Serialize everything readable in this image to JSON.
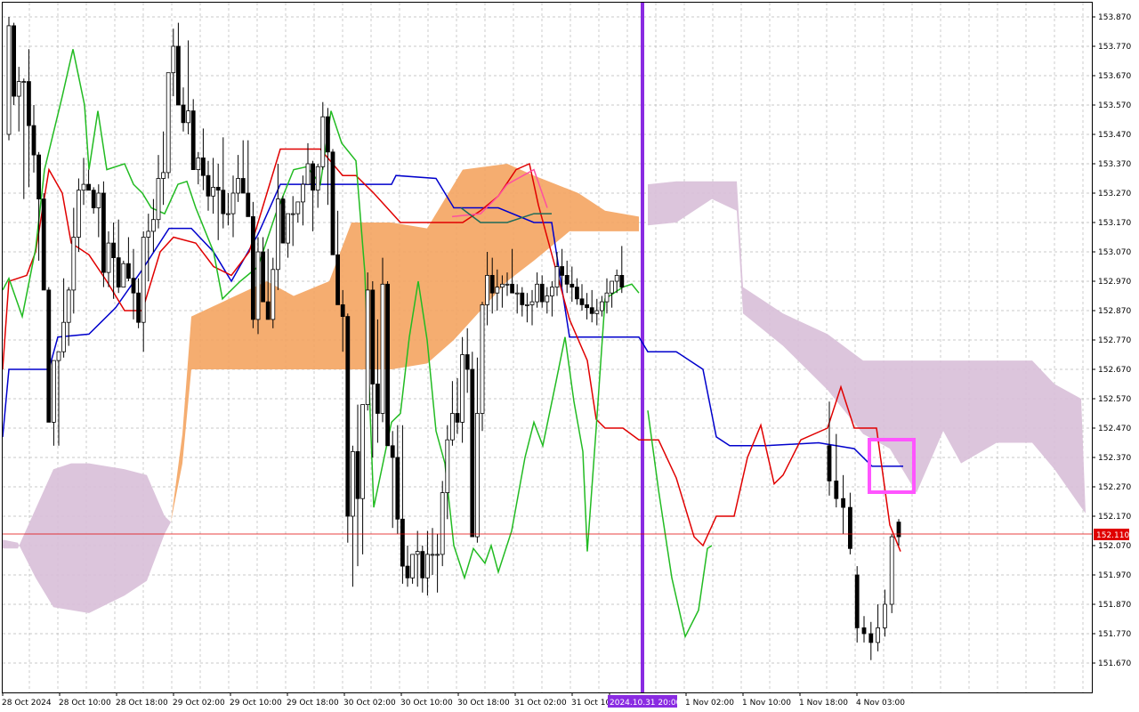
{
  "chart_data": {
    "type": "candlestick",
    "y_axis": {
      "ticks": [
        "153.870",
        "153.770",
        "153.670",
        "153.570",
        "153.470",
        "153.370",
        "153.270",
        "153.170",
        "153.070",
        "152.970",
        "152.870",
        "152.770",
        "152.670",
        "152.570",
        "152.470",
        "152.370",
        "152.270",
        "152.170",
        "152.070",
        "151.970",
        "151.870",
        "151.770",
        "151.670"
      ],
      "range": [
        151.61,
        153.91
      ]
    },
    "x_axis": {
      "labels": [
        "28 Oct 2024",
        "28 Oct 10:00",
        "28 Oct 18:00",
        "29 Oct 02:00",
        "29 Oct 10:00",
        "29 Oct 18:00",
        "30 Oct 02:00",
        "30 Oct 10:00",
        "30 Oct 18:00",
        "31 Oct 02:00",
        "31 Oct 10:00",
        "2024.10.31 20:00",
        "1 Nov 02:00",
        "1 Nov 10:00",
        "1 Nov 18:00",
        "4 Nov 03:00"
      ],
      "highlighted_label": "2024.10.31 20:00"
    },
    "current_price": {
      "value": 152.11,
      "label": "152.110"
    },
    "candles": [
      [
        153.47,
        153.87,
        153.45,
        153.84
      ],
      [
        153.84,
        153.85,
        153.57,
        153.6
      ],
      [
        153.6,
        153.7,
        153.48,
        153.65
      ],
      [
        153.65,
        153.66,
        153.25,
        153.65
      ],
      [
        153.65,
        153.76,
        153.29,
        153.5
      ],
      [
        153.5,
        153.57,
        153.34,
        153.4
      ],
      [
        153.4,
        153.41,
        153.04,
        153.25
      ],
      [
        153.25,
        153.27,
        152.94,
        152.94
      ],
      [
        152.94,
        152.95,
        152.49,
        152.49
      ],
      [
        152.49,
        152.7,
        152.41,
        152.7
      ],
      [
        152.7,
        152.73,
        152.41,
        152.73
      ],
      [
        152.73,
        152.98,
        152.71,
        152.83
      ],
      [
        152.83,
        152.95,
        152.75,
        152.94
      ],
      [
        152.94,
        153.22,
        152.86,
        153.12
      ],
      [
        153.12,
        153.32,
        153.07,
        153.28
      ],
      [
        153.28,
        153.39,
        153.23,
        153.3
      ],
      [
        153.3,
        153.35,
        153.28,
        153.28
      ],
      [
        153.28,
        153.29,
        153.2,
        153.22
      ],
      [
        153.22,
        153.3,
        153.12,
        153.27
      ],
      [
        153.27,
        153.31,
        152.95,
        153.0
      ],
      [
        153.0,
        153.14,
        152.95,
        153.1
      ],
      [
        153.1,
        153.17,
        152.91,
        153.05
      ],
      [
        153.05,
        153.18,
        152.93,
        152.95
      ],
      [
        152.95,
        153.04,
        152.95,
        153.03
      ],
      [
        153.03,
        153.12,
        152.97,
        152.98
      ],
      [
        152.98,
        153.08,
        152.84,
        152.93
      ],
      [
        152.93,
        152.98,
        152.81,
        152.83
      ],
      [
        152.83,
        153.14,
        152.73,
        153.12
      ],
      [
        153.12,
        153.2,
        152.97,
        153.14
      ],
      [
        153.14,
        153.25,
        153.07,
        153.18
      ],
      [
        153.18,
        153.4,
        153.15,
        153.32
      ],
      [
        153.32,
        153.48,
        153.23,
        153.34
      ],
      [
        153.34,
        153.68,
        153.32,
        153.68
      ],
      [
        153.68,
        153.83,
        153.6,
        153.77
      ],
      [
        153.77,
        153.85,
        153.6,
        153.57
      ],
      [
        153.57,
        153.63,
        153.48,
        153.51
      ],
      [
        153.51,
        153.79,
        153.47,
        153.55
      ],
      [
        153.55,
        153.59,
        153.35,
        153.35
      ],
      [
        153.35,
        153.41,
        153.3,
        153.39
      ],
      [
        153.39,
        153.49,
        153.28,
        153.33
      ],
      [
        153.33,
        153.38,
        153.21,
        153.26
      ],
      [
        153.26,
        153.39,
        153.2,
        153.29
      ],
      [
        153.29,
        153.37,
        153.11,
        153.28
      ],
      [
        153.28,
        153.46,
        153.15,
        153.2
      ],
      [
        153.2,
        153.27,
        153.16,
        153.2
      ],
      [
        153.2,
        153.33,
        153.12,
        153.27
      ],
      [
        153.27,
        153.4,
        153.24,
        153.32
      ],
      [
        153.32,
        153.45,
        153.27,
        153.27
      ],
      [
        153.27,
        153.45,
        153.21,
        153.19
      ],
      [
        153.19,
        153.24,
        152.81,
        152.84
      ],
      [
        152.84,
        153.12,
        152.79,
        153.07
      ],
      [
        153.07,
        153.12,
        152.9,
        152.9
      ],
      [
        152.9,
        153.08,
        152.84,
        152.84
      ],
      [
        152.84,
        153.05,
        152.81,
        153.01
      ],
      [
        153.01,
        153.37,
        152.94,
        153.25
      ],
      [
        153.25,
        153.26,
        153.1,
        153.1
      ],
      [
        153.1,
        153.2,
        153.05,
        153.2
      ],
      [
        153.2,
        153.26,
        153.09,
        153.2
      ],
      [
        153.2,
        153.24,
        153.17,
        153.24
      ],
      [
        153.24,
        153.33,
        153.16,
        153.3
      ],
      [
        153.3,
        153.44,
        153.3,
        153.37
      ],
      [
        153.37,
        153.38,
        153.14,
        153.28
      ],
      [
        153.28,
        153.37,
        153.22,
        153.36
      ],
      [
        153.36,
        153.58,
        153.35,
        153.53
      ],
      [
        153.53,
        153.56,
        153.23,
        153.41
      ],
      [
        153.41,
        153.42,
        153.06,
        153.06
      ],
      [
        153.06,
        153.21,
        152.89,
        152.89
      ],
      [
        152.89,
        152.94,
        152.73,
        152.85
      ],
      [
        152.85,
        152.86,
        152.08,
        152.17
      ],
      [
        152.17,
        152.41,
        151.93,
        152.39
      ],
      [
        152.39,
        152.55,
        152.0,
        152.23
      ],
      [
        152.23,
        152.55,
        152.04,
        152.55
      ],
      [
        152.55,
        153.0,
        152.53,
        152.94
      ],
      [
        152.94,
        152.97,
        152.37,
        152.62
      ],
      [
        152.62,
        152.84,
        152.42,
        152.52
      ],
      [
        152.52,
        153.05,
        152.49,
        152.96
      ],
      [
        152.96,
        152.97,
        152.41,
        152.41
      ],
      [
        152.41,
        152.46,
        152.13,
        152.37
      ],
      [
        152.37,
        152.48,
        152.11,
        152.16
      ],
      [
        152.16,
        152.48,
        151.94,
        152.0
      ],
      [
        152.0,
        152.07,
        151.93,
        151.96
      ],
      [
        151.96,
        152.04,
        151.94,
        152.04
      ],
      [
        152.04,
        152.12,
        151.93,
        152.05
      ],
      [
        152.05,
        152.07,
        151.91,
        151.96
      ],
      [
        151.96,
        152.12,
        151.9,
        152.04
      ],
      [
        152.04,
        152.13,
        151.97,
        152.04
      ],
      [
        152.04,
        152.11,
        151.91,
        152.04
      ],
      [
        152.04,
        152.29,
        152.0,
        152.25
      ],
      [
        152.25,
        152.48,
        152.16,
        152.43
      ],
      [
        152.43,
        152.63,
        152.41,
        152.52
      ],
      [
        152.52,
        152.64,
        152.45,
        152.49
      ],
      [
        152.49,
        152.78,
        152.42,
        152.72
      ],
      [
        152.72,
        152.81,
        152.59,
        152.67
      ],
      [
        152.67,
        152.73,
        152.1,
        152.1
      ],
      [
        152.1,
        152.71,
        152.08,
        152.52
      ],
      [
        152.52,
        152.9,
        152.46,
        152.89
      ],
      [
        152.89,
        153.07,
        152.82,
        152.99
      ],
      [
        152.99,
        153.05,
        152.86,
        152.93
      ],
      [
        152.93,
        153.01,
        152.87,
        152.95
      ],
      [
        152.95,
        152.99,
        152.88,
        152.96
      ],
      [
        152.96,
        153.0,
        152.92,
        152.96
      ],
      [
        152.96,
        153.08,
        152.93,
        152.93
      ],
      [
        152.93,
        152.96,
        152.86,
        152.93
      ],
      [
        152.93,
        152.95,
        152.85,
        152.89
      ],
      [
        152.89,
        152.93,
        152.83,
        152.89
      ],
      [
        152.89,
        152.94,
        152.82,
        152.9
      ],
      [
        152.9,
        153.0,
        152.88,
        152.96
      ],
      [
        152.96,
        152.99,
        152.88,
        152.9
      ],
      [
        152.9,
        152.95,
        152.86,
        152.92
      ],
      [
        152.92,
        152.97,
        152.85,
        152.95
      ],
      [
        152.95,
        153.07,
        152.92,
        153.02
      ],
      [
        153.02,
        153.08,
        152.95,
        152.99
      ],
      [
        152.99,
        153.04,
        152.93,
        152.96
      ],
      [
        152.96,
        153.02,
        152.9,
        152.95
      ],
      [
        152.95,
        152.98,
        152.89,
        152.91
      ],
      [
        152.91,
        152.96,
        152.87,
        152.89
      ],
      [
        152.89,
        152.93,
        152.84,
        152.88
      ],
      [
        152.88,
        152.94,
        152.83,
        152.86
      ],
      [
        152.86,
        152.91,
        152.82,
        152.87
      ],
      [
        152.87,
        152.92,
        152.85,
        152.9
      ],
      [
        152.9,
        152.98,
        152.86,
        152.93
      ],
      [
        152.93,
        152.97,
        152.88,
        152.97
      ],
      [
        152.97,
        153.01,
        152.93,
        152.99
      ],
      [
        152.99,
        153.09,
        152.93,
        152.95
      ],
      [
        152.41,
        152.56,
        152.24,
        152.29
      ],
      [
        152.29,
        152.45,
        152.2,
        152.23
      ],
      [
        152.23,
        152.31,
        152.11,
        152.2
      ],
      [
        152.2,
        152.25,
        152.04,
        152.06
      ],
      [
        151.97,
        152.0,
        151.74,
        151.79
      ],
      [
        151.79,
        151.83,
        151.74,
        151.77
      ],
      [
        151.77,
        151.81,
        151.68,
        151.74
      ],
      [
        151.74,
        151.87,
        151.71,
        151.79
      ],
      [
        151.79,
        151.92,
        151.76,
        151.87
      ],
      [
        151.87,
        152.11,
        151.84,
        152.1
      ],
      [
        152.15,
        152.16,
        152.07,
        152.1
      ]
    ],
    "series": [
      {
        "name": "Tenkan",
        "color": "#e00000"
      },
      {
        "name": "Kijun",
        "color": "#0000cc"
      },
      {
        "name": "Chikou",
        "color": "#22bb22"
      },
      {
        "name": "Kumo bullish",
        "color": "#f4a460"
      },
      {
        "name": "Kumo bearish",
        "color": "#d8bfd8"
      }
    ],
    "markers": {
      "vertical_line_color": "#8a2be2",
      "highlight_box_color": "#ff55ff"
    }
  }
}
